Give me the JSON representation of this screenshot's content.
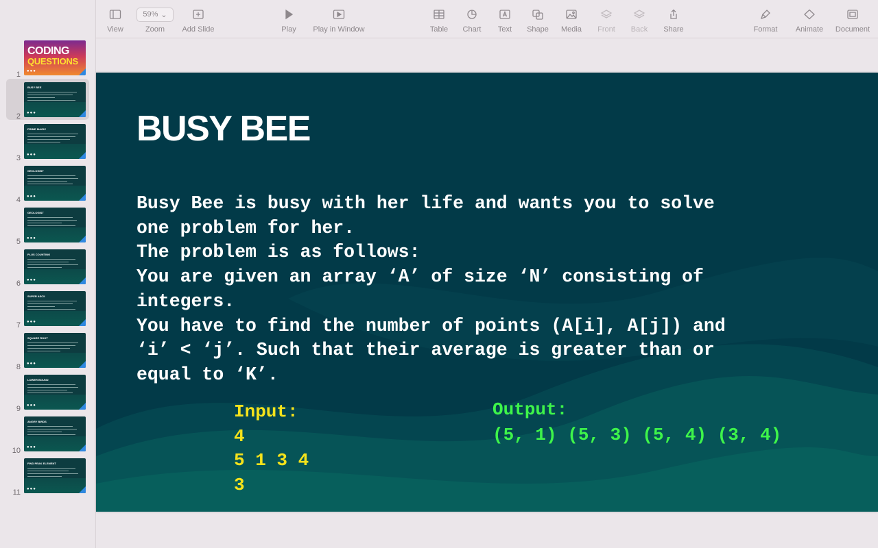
{
  "toolbar": {
    "view": "View",
    "zoom_value": "59%",
    "zoom": "Zoom",
    "add_slide": "Add Slide",
    "play": "Play",
    "play_in_window": "Play in Window",
    "table": "Table",
    "chart": "Chart",
    "text": "Text",
    "shape": "Shape",
    "media": "Media",
    "front": "Front",
    "back": "Back",
    "share": "Share",
    "format": "Format",
    "animate": "Animate",
    "document": "Document"
  },
  "slides": [
    {
      "num": "1",
      "cover_top": "CODING",
      "cover_bottom": "QUESTIONS"
    },
    {
      "num": "2",
      "title": "BUSY BEE"
    },
    {
      "num": "3",
      "title": "PRIME MAGIC"
    },
    {
      "num": "4",
      "title": "GEOLOGIST"
    },
    {
      "num": "5",
      "title": "GEOLOGIST"
    },
    {
      "num": "6",
      "title": "PLUS COUNTING"
    },
    {
      "num": "7",
      "title": "SUPER ASCII"
    },
    {
      "num": "8",
      "title": "SQUARE ROOT"
    },
    {
      "num": "9",
      "title": "LOWER BOUND"
    },
    {
      "num": "10",
      "title": "ANGRY BIRDS"
    },
    {
      "num": "11",
      "title": "FIND PEAK ELEMENT"
    }
  ],
  "slide": {
    "title": "BUSY BEE",
    "body": [
      "Busy Bee is busy with her life and wants you to solve",
      "one problem for her.",
      "The problem is as follows:",
      "You are given an array ‘A’ of size ‘N’ consisting of",
      "integers.",
      "You have to find the number of points (A[i], A[j]) and",
      "‘i’ < ‘j’. Such that their average is greater than or",
      "equal to ‘K’."
    ],
    "input_label": "Input:",
    "input_lines": [
      "4",
      "5 1 3 4",
      "3"
    ],
    "output_label": "Output:",
    "output_value": "(5, 1) (5, 3) (5, 4) (3, 4)"
  }
}
